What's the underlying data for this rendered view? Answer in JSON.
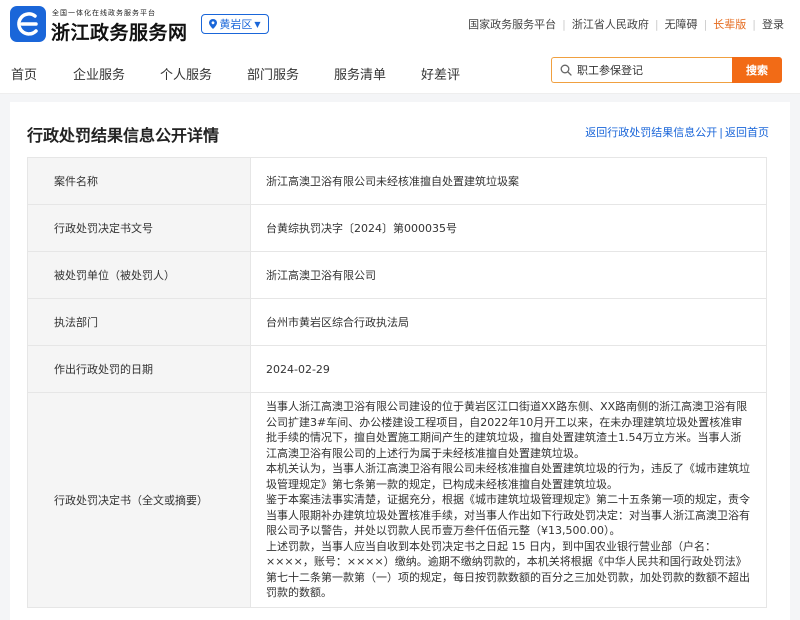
{
  "header": {
    "logo_subtitle": "全国一体化在线政务服务平台",
    "logo_title": "浙江政务服务网",
    "region": "黄岩区",
    "links": [
      {
        "label": "国家政务服务平台",
        "elder": false
      },
      {
        "label": "浙江省人民政府",
        "elder": false
      },
      {
        "label": "无障碍",
        "elder": false
      },
      {
        "label": "长辈版",
        "elder": true
      },
      {
        "label": "登录",
        "elder": false
      }
    ],
    "brand_color": "#1a66d9",
    "accent_color": "#f26b16"
  },
  "nav": {
    "items": [
      "首页",
      "企业服务",
      "个人服务",
      "部门服务",
      "服务清单",
      "好差评"
    ],
    "search_value": "职工参保登记",
    "search_button": "搜索"
  },
  "page": {
    "title": "行政处罚结果信息公开详情",
    "back_list": "返回行政处罚结果信息公开",
    "separator": "|",
    "back_home": "返回首页"
  },
  "details": [
    {
      "label": "案件名称",
      "value": "浙江高澳卫浴有限公司未经核准擅自处置建筑垃圾案"
    },
    {
      "label": "行政处罚决定书文号",
      "value": "台黄综执罚决字〔2024〕第000035号"
    },
    {
      "label": "被处罚单位（被处罚人）",
      "value": "浙江高澳卫浴有限公司"
    },
    {
      "label": "执法部门",
      "value": "台州市黄岩区综合行政执法局"
    },
    {
      "label": "作出行政处罚的日期",
      "value": "2024-02-29"
    },
    {
      "label": "行政处罚决定书（全文或摘要）",
      "paragraphs": [
        "当事人浙江高澳卫浴有限公司建设的位于黄岩区江口街道XX路东侧、XX路南侧的浙江高澳卫浴有限公司扩建3#车间、办公楼建设工程项目，自2022年10月开工以来，在未办理建筑垃圾处置核准审批手续的情况下，擅自处置施工期间产生的建筑垃圾，擅自处置建筑渣土1.54万立方米。当事人浙江高澳卫浴有限公司的上述行为属于未经核准擅自处置建筑垃圾。",
        "本机关认为，当事人浙江高澳卫浴有限公司未经核准擅自处置建筑垃圾的行为，违反了《城市建筑垃圾管理规定》第七条第一款的规定，已构成未经核准擅自处置建筑垃圾。",
        "鉴于本案违法事实清楚，证据充分，根据《城市建筑垃圾管理规定》第二十五条第一项的规定，责令当事人限期补办建筑垃圾处置核准手续，对当事人作出如下行政处罚决定：对当事人浙江高澳卫浴有限公司予以警告，并处以罚款人民币壹万叁仟伍佰元整（¥13,500.00）。",
        "上述罚款，当事人应当自收到本处罚决定书之日起 15 日内，到中国农业银行营业部（户名：××××，账号：××××）缴纳。逾期不缴纳罚款的，本机关将根据《中华人民共和国行政处罚法》第七十二条第一款第（一）项的规定，每日按罚款数额的百分之三加处罚款，加处罚款的数额不超出罚款的数额。"
      ]
    }
  ]
}
